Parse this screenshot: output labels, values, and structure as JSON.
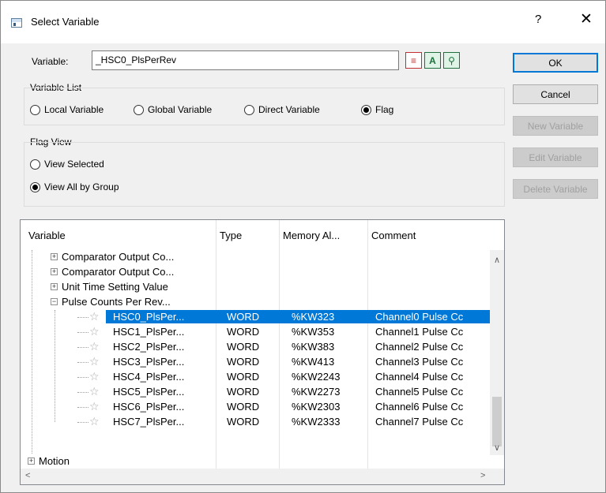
{
  "window": {
    "title": "Select Variable",
    "help": "?",
    "close": "✕"
  },
  "variable": {
    "label": "Variable:",
    "value": "_HSC0_PlsPerRev"
  },
  "variable_list": {
    "label": "Variable List",
    "options": [
      "Local Variable",
      "Global Variable",
      "Direct Variable",
      "Flag"
    ],
    "selected": "Flag"
  },
  "flag_view": {
    "label": "Flag View",
    "options": [
      "View Selected",
      "View All by Group"
    ],
    "selected": "View All by Group"
  },
  "buttons": {
    "ok": "OK",
    "cancel": "Cancel",
    "new_variable": "New Variable",
    "edit_variable": "Edit Variable",
    "delete_variable": "Delete Variable"
  },
  "tools": {
    "tool1": "≡",
    "tool2": "A",
    "tool3": "⚲"
  },
  "table": {
    "columns": [
      "Variable",
      "Type",
      "Memory Al...",
      "Comment"
    ],
    "groups": [
      {
        "label": "Comparator Output Co...",
        "expanded": false
      },
      {
        "label": "Comparator Output Co...",
        "expanded": false
      },
      {
        "label": "Unit Time Setting Value",
        "expanded": false
      },
      {
        "label": "Pulse Counts Per Rev...",
        "expanded": true
      }
    ],
    "rows": [
      {
        "name": "HSC0_PlsPer...",
        "type": "WORD",
        "memory": "%KW323",
        "comment": "Channel0 Pulse Cc",
        "selected": true
      },
      {
        "name": "HSC1_PlsPer...",
        "type": "WORD",
        "memory": "%KW353",
        "comment": "Channel1 Pulse Cc",
        "selected": false
      },
      {
        "name": "HSC2_PlsPer...",
        "type": "WORD",
        "memory": "%KW383",
        "comment": "Channel2 Pulse Cc",
        "selected": false
      },
      {
        "name": "HSC3_PlsPer...",
        "type": "WORD",
        "memory": "%KW413",
        "comment": "Channel3 Pulse Cc",
        "selected": false
      },
      {
        "name": "HSC4_PlsPer...",
        "type": "WORD",
        "memory": "%KW2243",
        "comment": "Channel4 Pulse Cc",
        "selected": false
      },
      {
        "name": "HSC5_PlsPer...",
        "type": "WORD",
        "memory": "%KW2273",
        "comment": "Channel5 Pulse Cc",
        "selected": false
      },
      {
        "name": "HSC6_PlsPer...",
        "type": "WORD",
        "memory": "%KW2303",
        "comment": "Channel6 Pulse Cc",
        "selected": false
      },
      {
        "name": "HSC7_PlsPer...",
        "type": "WORD",
        "memory": "%KW2333",
        "comment": "Channel7 Pulse Cc",
        "selected": false
      }
    ],
    "last_group": {
      "label": "Motion",
      "expanded": false
    }
  }
}
